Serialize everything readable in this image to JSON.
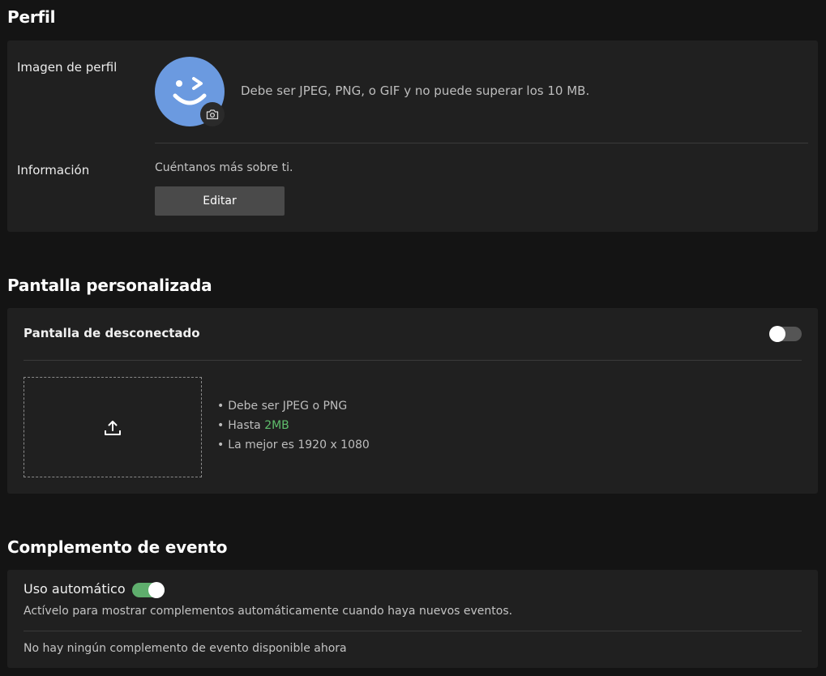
{
  "profile": {
    "title": "Perfil",
    "image_label": "Imagen de perfil",
    "image_hint": "Debe ser JPEG, PNG, o GIF y no puede superar los 10 MB.",
    "info_label": "Información",
    "info_text": "Cuéntanos más sobre ti.",
    "edit_button": "Editar",
    "avatar_color": "#6b9ae0"
  },
  "custom_screen": {
    "title": "Pantalla personalizada",
    "offline_label": "Pantalla de desconectado",
    "offline_toggle_on": false,
    "requirements": {
      "format": "Debe ser JPEG o PNG",
      "size_prefix": "Hasta ",
      "size_value": "2MB",
      "resolution": "La mejor es 1920 x 1080"
    },
    "upload_icon": "upload-icon"
  },
  "event_addon": {
    "title": "Complemento de evento",
    "auto_label": "Uso automático",
    "auto_toggle_on": true,
    "auto_description": "Actívelo para mostrar complementos automáticamente cuando haya nuevos eventos.",
    "empty_text": "No hay ningún complemento de evento disponible ahora"
  },
  "colors": {
    "accent_green": "#5fbf6d",
    "toggle_on": "#5fae6d",
    "card_bg": "#202020",
    "page_bg": "#141414"
  }
}
